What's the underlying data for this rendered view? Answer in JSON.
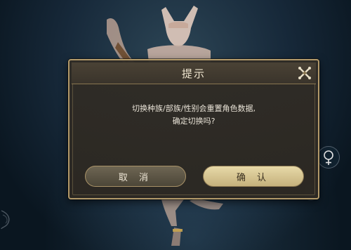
{
  "dialog": {
    "title": "提示",
    "message_line1": "切换种族/部族/性别会重置角色数据,",
    "message_line2": "确定切换吗?",
    "cancel_label": "取 消",
    "confirm_label": "确 认",
    "close_icon": "close-x-icon"
  },
  "side_controls": {
    "gender_icon": "female-symbol-icon"
  },
  "colors": {
    "dialog_border": "#b39a6a",
    "dialog_bg": "#302c26",
    "confirm_button": "#d8c690",
    "cancel_button": "#5c5544",
    "text": "#e8e2d6"
  }
}
